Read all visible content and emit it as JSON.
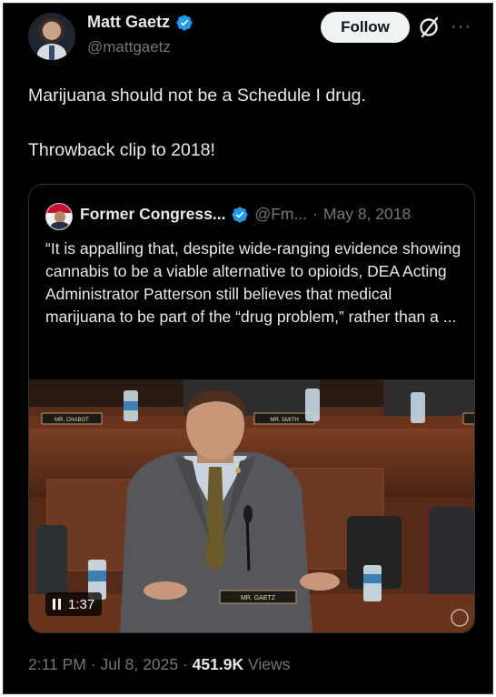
{
  "author": {
    "name": "Matt Gaetz",
    "handle": "@mattgaetz",
    "verified_color": "#1d9bf0"
  },
  "actions": {
    "follow_label": "Follow",
    "grok_icon": "grok-icon",
    "more_icon": "more-icon",
    "more_glyph": "···"
  },
  "tweet": {
    "text": "Marijuana should not be a Schedule I drug.\n\nThrowback clip to 2018!"
  },
  "quote": {
    "name": "Former Congress...",
    "handle": "@Fm...",
    "separator": "·",
    "date": "May 8, 2018",
    "text": "“It is appalling that, despite wide-ranging evidence showing cannabis to be a viable alternative to opioids, DEA Acting Administrator Patterson still believes that medical marijuana to be part of the “drug problem,” rather than a ...",
    "video": {
      "time": "1:37",
      "nameplates": [
        "MR. CHABOT",
        "MR. SMITH",
        "MR. GAETZ"
      ]
    }
  },
  "meta": {
    "time": "2:11 PM",
    "sep1": "·",
    "date": "Jul 8, 2025",
    "sep2": "·",
    "views_count": "451.9K",
    "views_label": "Views"
  }
}
